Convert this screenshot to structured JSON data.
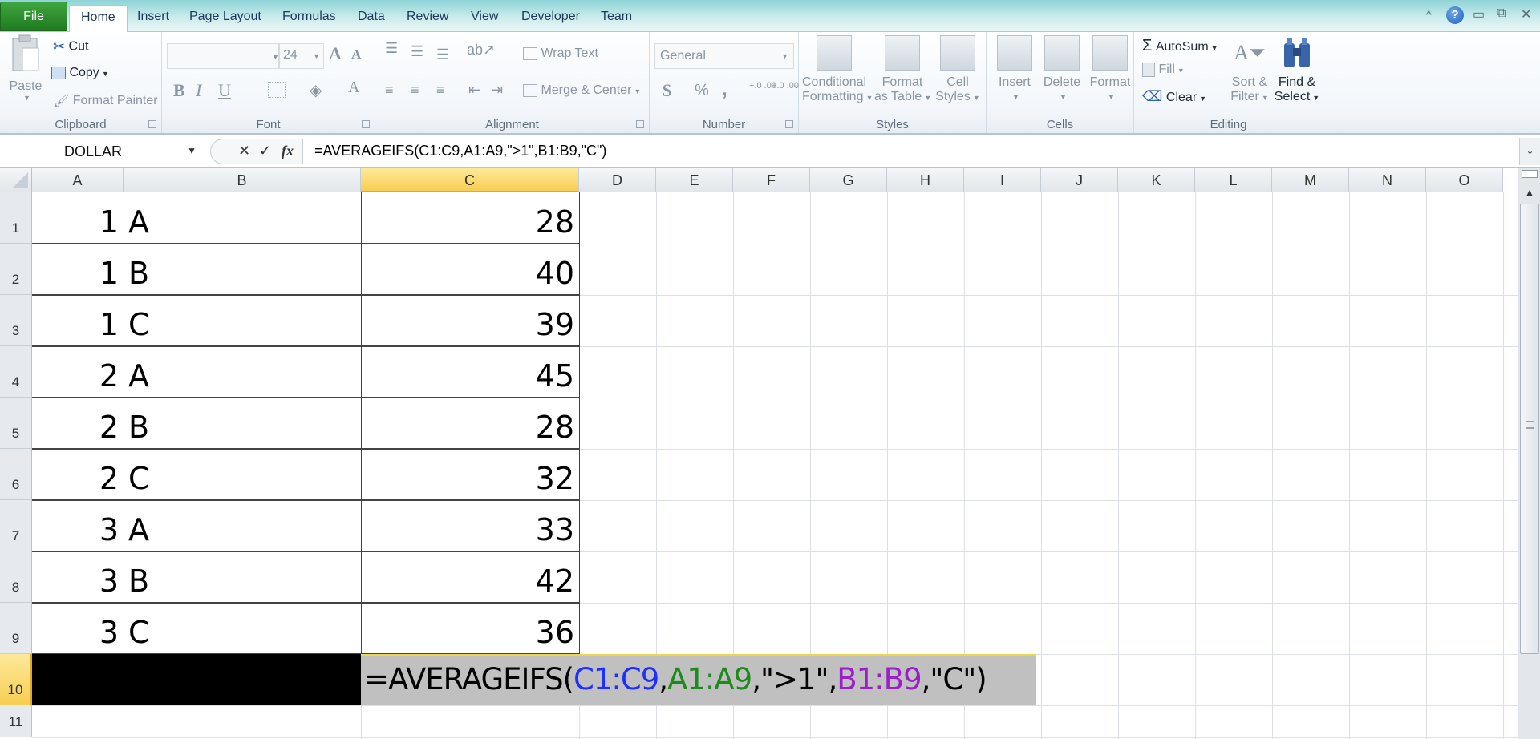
{
  "tabs": {
    "file": "File",
    "items": [
      "Home",
      "Insert",
      "Page Layout",
      "Formulas",
      "Data",
      "Review",
      "View",
      "Developer",
      "Team"
    ],
    "active": "Home"
  },
  "window_controls": {
    "minimize_ribbon": "^",
    "help": "?",
    "minimize": "▭",
    "restore": "⧉",
    "close": "✕"
  },
  "ribbon": {
    "clipboard": {
      "label": "Clipboard",
      "paste": "Paste",
      "cut": "Cut",
      "copy": "Copy",
      "format_painter": "Format Painter"
    },
    "font": {
      "label": "Font",
      "font_name": "",
      "font_size": "24",
      "bold": "B",
      "italic": "I",
      "underline": "U",
      "grow": "A",
      "shrink": "A",
      "font_color": "A"
    },
    "alignment": {
      "label": "Alignment",
      "wrap_text": "Wrap Text",
      "merge_center": "Merge & Center"
    },
    "number": {
      "label": "Number",
      "format": "General",
      "currency": "$",
      "percent": "%",
      "comma": ",",
      "inc_decimal": "+.0 .00",
      "dec_decimal": "+.0 .00"
    },
    "styles": {
      "label": "Styles",
      "conditional_formatting": [
        "Conditional",
        "Formatting"
      ],
      "format_as_table": [
        "Format",
        "as Table"
      ],
      "cell_styles": [
        "Cell",
        "Styles"
      ]
    },
    "cells": {
      "label": "Cells",
      "insert": "Insert",
      "delete": "Delete",
      "format": "Format"
    },
    "editing": {
      "label": "Editing",
      "autosum": "AutoSum",
      "fill": "Fill",
      "clear": "Clear",
      "sort_filter": [
        "Sort &",
        "Filter"
      ],
      "find_select": [
        "Find &",
        "Select"
      ]
    }
  },
  "formula_bar": {
    "name_box": "DOLLAR",
    "cancel": "✕",
    "enter": "✓",
    "fx": "fx",
    "formula": "=AVERAGEIFS(C1:C9,A1:A9,\">1\",B1:B9,\"C\")"
  },
  "sheet": {
    "columns": [
      "A",
      "B",
      "C",
      "D",
      "E",
      "F",
      "G",
      "H",
      "I",
      "J",
      "K",
      "L",
      "M",
      "N",
      "O"
    ],
    "selected_column": "C",
    "rows": [
      "1",
      "2",
      "3",
      "4",
      "5",
      "6",
      "7",
      "8",
      "9",
      "10",
      "11"
    ],
    "selected_row": "10",
    "data": [
      {
        "a": "1",
        "b": "A",
        "c": "28"
      },
      {
        "a": "1",
        "b": "B",
        "c": "40"
      },
      {
        "a": "1",
        "b": "C",
        "c": "39"
      },
      {
        "a": "2",
        "b": "A",
        "c": "45"
      },
      {
        "a": "2",
        "b": "B",
        "c": "28"
      },
      {
        "a": "2",
        "b": "C",
        "c": "32"
      },
      {
        "a": "3",
        "b": "A",
        "c": "33"
      },
      {
        "a": "3",
        "b": "B",
        "c": "42"
      },
      {
        "a": "3",
        "b": "C",
        "c": "36"
      }
    ],
    "edit_cell": {
      "address": "C10",
      "parts": [
        {
          "text": "=AVERAGEIFS(",
          "color": "#000000"
        },
        {
          "text": "C1:C9",
          "color": "#1f2fff"
        },
        {
          "text": ",",
          "color": "#000000"
        },
        {
          "text": "A1:A9",
          "color": "#1c8a1c"
        },
        {
          "text": ",\">1\",",
          "color": "#000000"
        },
        {
          "text": "B1:B9",
          "color": "#9a1fc8"
        },
        {
          "text": ",\"C\")",
          "color": "#000000"
        }
      ]
    }
  }
}
